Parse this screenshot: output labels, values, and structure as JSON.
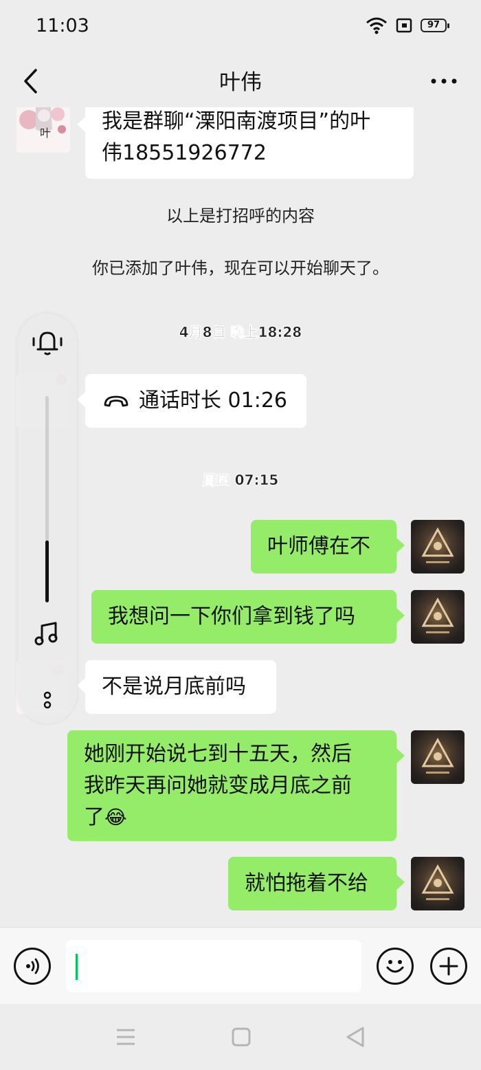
{
  "status_bar": {
    "time": "11:03",
    "battery": "97"
  },
  "header": {
    "title": "叶伟"
  },
  "avatar_text": "叶",
  "messages": {
    "greeting": {
      "line1": "我是群聊“溧阳南渡项目”的叶",
      "line2": "伟18551926772"
    },
    "sys_greeting_note": "以上是打招呼的内容",
    "sys_added": "你已添加了叶伟，现在可以开始聊天了。",
    "time_1": "4月8日 晚上18:28",
    "call": {
      "label": "通话时长 01:26"
    },
    "time_2": "周四 07:15",
    "me_1": "叶师傅在不",
    "me_2": "我想问一下你们拿到钱了吗",
    "her_3": "不是说月底前吗",
    "me_3": {
      "line1": "她刚开始说七到十五天，然后",
      "line2": "我昨天再问她就变成月底之前",
      "line3": "了",
      "emoji": "😂"
    },
    "me_4": "就怕拖着不给"
  },
  "floating_panel": {
    "volume_level": 0.3
  },
  "input": {
    "value": ""
  },
  "colors": {
    "sent_bubble": "#95ec69",
    "received_bubble": "#ffffff",
    "caret": "#07c160"
  },
  "icons": [
    "back-arrow-icon",
    "more-dots-icon",
    "wifi-icon",
    "sim-icon",
    "battery-icon",
    "bell-icon",
    "music-note-icon",
    "phone-hangup-icon",
    "voice-icon",
    "emoji-icon",
    "plus-icon",
    "menu-lines-icon",
    "home-square-icon",
    "back-triangle-icon"
  ]
}
